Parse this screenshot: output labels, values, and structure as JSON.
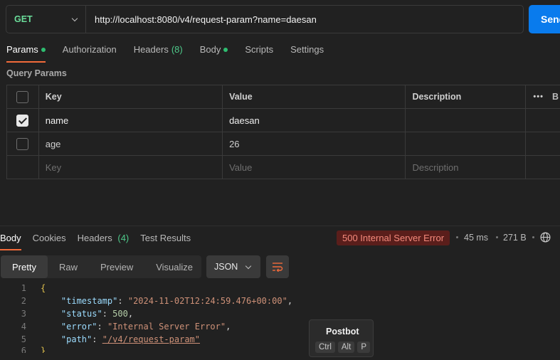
{
  "request": {
    "method": "GET",
    "url": "http://localhost:8080/v4/request-param?name=daesan",
    "send_label": "Send"
  },
  "request_tabs": [
    {
      "label": "Params",
      "indicator": "dot"
    },
    {
      "label": "Authorization"
    },
    {
      "label": "Headers",
      "count": "(8)"
    },
    {
      "label": "Body",
      "indicator": "dot"
    },
    {
      "label": "Scripts"
    },
    {
      "label": "Settings"
    }
  ],
  "query_params": {
    "title": "Query Params",
    "headers": {
      "key": "Key",
      "value": "Value",
      "description": "Description",
      "more": "B"
    },
    "rows": [
      {
        "checked": true,
        "key": "name",
        "value": "daesan",
        "description": ""
      },
      {
        "checked": false,
        "key": "age",
        "value": "26",
        "description": ""
      }
    ],
    "placeholder": {
      "key": "Key",
      "value": "Value",
      "description": "Description"
    }
  },
  "response_tabs": [
    {
      "label": "Body"
    },
    {
      "label": "Cookies"
    },
    {
      "label": "Headers",
      "count": "(4)"
    },
    {
      "label": "Test Results"
    }
  ],
  "response_status": {
    "status": "500 Internal Server Error",
    "time": "45 ms",
    "size": "271 B",
    "status_color": "#5a1e1b"
  },
  "view_modes": [
    "Pretty",
    "Raw",
    "Preview",
    "Visualize"
  ],
  "format": "JSON",
  "code": {
    "line_numbers": [
      "1",
      "2",
      "3",
      "4",
      "5",
      "6"
    ],
    "open_brace": "{",
    "close_brace": "}",
    "fields": [
      {
        "key": "\"timestamp\"",
        "value": "\"2024-11-02T12:24:59.476+00:00\"",
        "sep": ","
      },
      {
        "key": "\"status\"",
        "value": "500",
        "sep": ","
      },
      {
        "key": "\"error\"",
        "value": "\"Internal Server Error\"",
        "sep": ","
      },
      {
        "key": "\"path\"",
        "value": "\"/v4/request-param\"",
        "sep": ""
      }
    ]
  },
  "postbot": {
    "title": "Postbot",
    "keys": [
      "Ctrl",
      "Alt",
      "P"
    ]
  },
  "icons": {
    "method_dropdown": "chevron-down-icon",
    "globe": "globe-icon",
    "wrap": "wrap-lines-icon",
    "more": "more-horizontal-icon",
    "accent": "#f26b3a",
    "send_color": "#097bed"
  }
}
